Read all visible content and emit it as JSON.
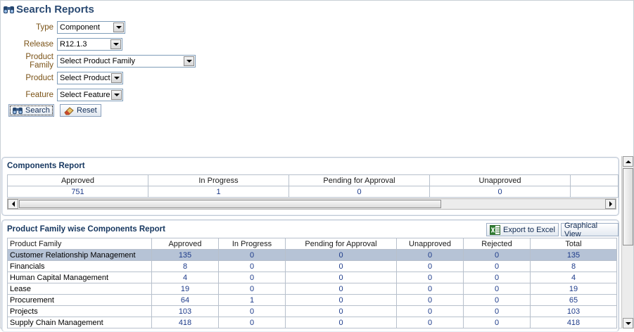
{
  "page_title": "Search Reports",
  "form": {
    "type": {
      "label": "Type",
      "value": "Component"
    },
    "release": {
      "label": "Release",
      "value": "R12.1.3"
    },
    "product_family": {
      "label": "Product Family",
      "value": "Select Product Family"
    },
    "product": {
      "label": "Product",
      "value": "Select Product"
    },
    "feature": {
      "label": "Feature",
      "value": "Select Feature"
    },
    "search_label": "Search",
    "reset_label": "Reset"
  },
  "components_report": {
    "title": "Components Report",
    "headers": [
      "Approved",
      "In Progress",
      "Pending for Approval",
      "Unapproved",
      ""
    ],
    "values": [
      "751",
      "1",
      "0",
      "0",
      ""
    ]
  },
  "family_report": {
    "title": "Product Family wise Components Report",
    "export_label": "Export to Excel",
    "graph_label": "Graphical View",
    "headers": [
      "Product Family",
      "Approved",
      "In Progress",
      "Pending for Approval",
      "Unapproved",
      "Rejected",
      "Total"
    ],
    "rows": [
      {
        "family": "Customer Relationship Management",
        "approved": "135",
        "in_progress": "0",
        "pending": "0",
        "unapproved": "0",
        "rejected": "0",
        "total": "135"
      },
      {
        "family": "Financials",
        "approved": "8",
        "in_progress": "0",
        "pending": "0",
        "unapproved": "0",
        "rejected": "0",
        "total": "8"
      },
      {
        "family": "Human Capital Management",
        "approved": "4",
        "in_progress": "0",
        "pending": "0",
        "unapproved": "0",
        "rejected": "0",
        "total": "4"
      },
      {
        "family": "Lease",
        "approved": "19",
        "in_progress": "0",
        "pending": "0",
        "unapproved": "0",
        "rejected": "0",
        "total": "19"
      },
      {
        "family": "Procurement",
        "approved": "64",
        "in_progress": "1",
        "pending": "0",
        "unapproved": "0",
        "rejected": "0",
        "total": "65"
      },
      {
        "family": "Projects",
        "approved": "103",
        "in_progress": "0",
        "pending": "0",
        "unapproved": "0",
        "rejected": "0",
        "total": "103"
      },
      {
        "family": "Supply Chain Management",
        "approved": "418",
        "in_progress": "0",
        "pending": "0",
        "unapproved": "0",
        "rejected": "0",
        "total": "418"
      }
    ]
  },
  "colors": {
    "title": "#2a4a72",
    "label": "#7a5216",
    "link_number": "#1d3b8a",
    "selected_row": "#b6c3d6"
  },
  "icons": {
    "title": "binoculars-icon",
    "search": "binoculars-icon",
    "reset": "eraser-icon",
    "export": "excel-icon"
  }
}
